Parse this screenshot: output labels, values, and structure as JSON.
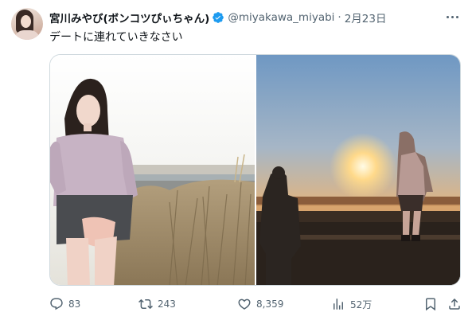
{
  "tweet": {
    "author_name": "宮川みやび(ボンコツぴぃちゃん)",
    "handle": "@miyakawa_miyabi",
    "separator": "·",
    "date": "2月23日",
    "text": "デートに連れていきなさい"
  },
  "media": {
    "image_count": 2
  },
  "actions": {
    "replies": "83",
    "reposts": "243",
    "likes": "8,359",
    "views": "52万"
  },
  "colors": {
    "accent": "#1d9bf0",
    "muted_text": "#536471",
    "border": "#cfd9de"
  },
  "icons": [
    "verified-badge-icon",
    "more-icon",
    "reply-icon",
    "repost-icon",
    "like-icon",
    "views-icon",
    "bookmark-icon",
    "share-icon"
  ]
}
